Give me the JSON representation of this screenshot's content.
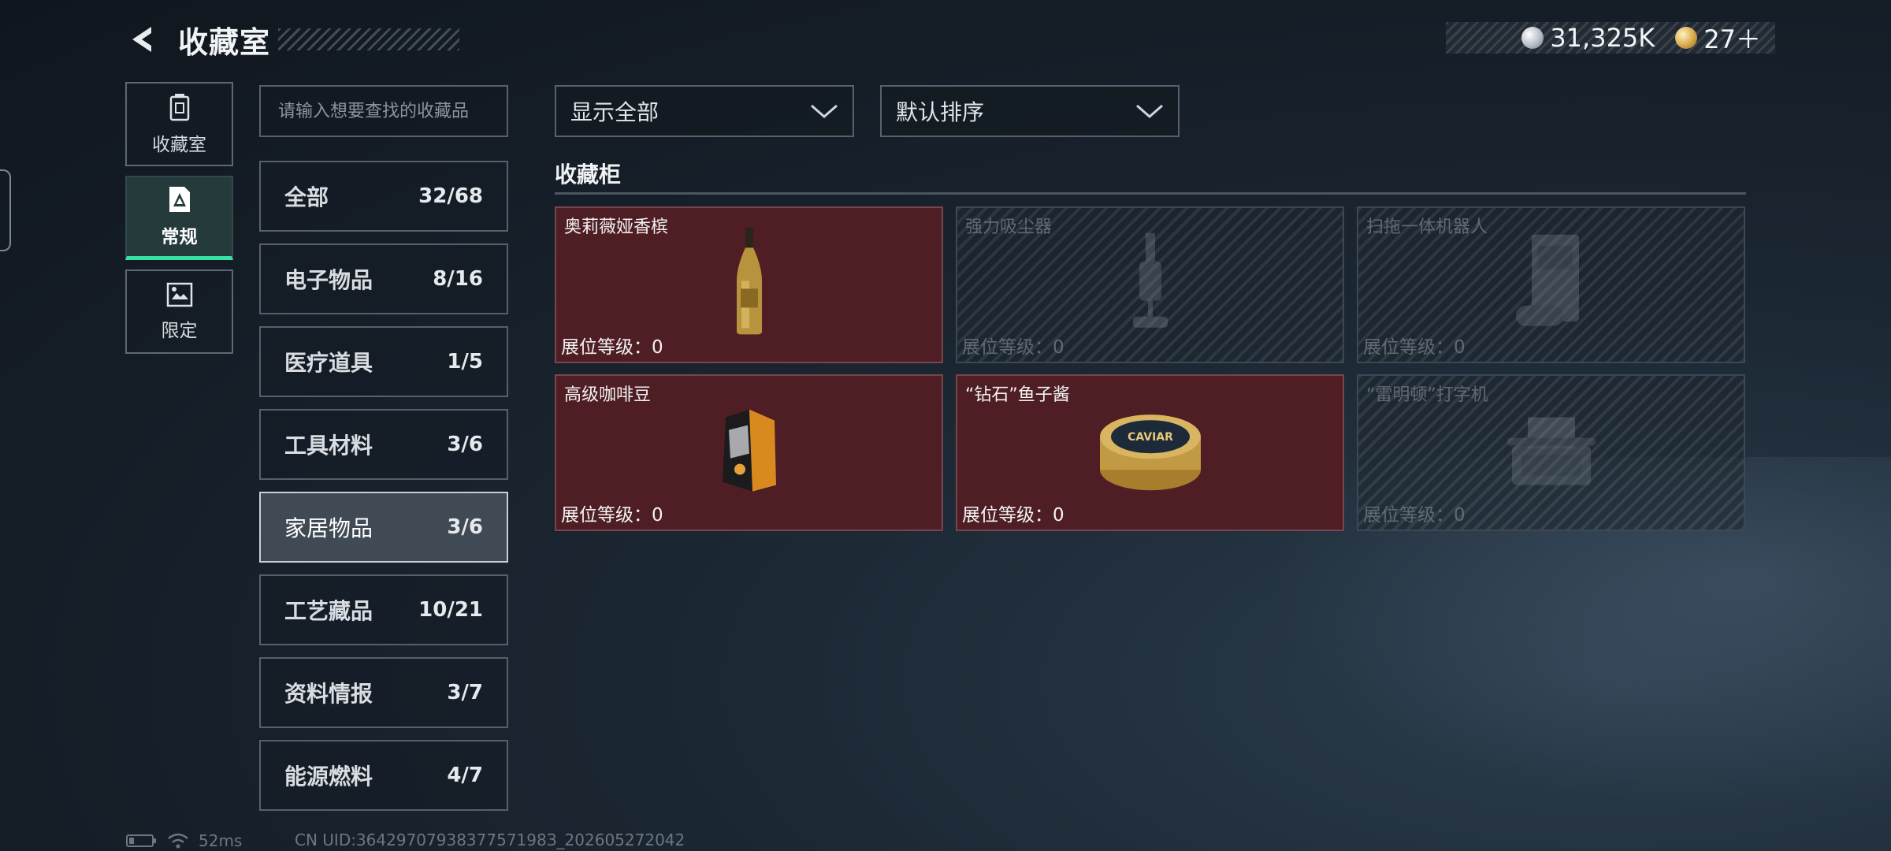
{
  "header": {
    "title": "收藏室",
    "currency": {
      "silver_amount": "31,325K",
      "gold_amount": "27＋"
    }
  },
  "sidenav": {
    "items": [
      {
        "label": "收藏室",
        "icon": "trash-bin-icon",
        "active": false
      },
      {
        "label": "常规",
        "icon": "document-a-icon",
        "active": true
      },
      {
        "label": "限定",
        "icon": "limited-card-icon",
        "active": false
      }
    ]
  },
  "search": {
    "placeholder": "请输入想要查找的收藏品"
  },
  "categories": [
    {
      "name": "全部",
      "count": "32/68"
    },
    {
      "name": "电子物品",
      "count": "8/16"
    },
    {
      "name": "医疗道具",
      "count": "1/5"
    },
    {
      "name": "工具材料",
      "count": "3/6"
    },
    {
      "name": "家居物品",
      "count": "3/6",
      "active": true
    },
    {
      "name": "工艺藏品",
      "count": "10/21"
    },
    {
      "name": "资料情报",
      "count": "3/7"
    },
    {
      "name": "能源燃料",
      "count": "4/7"
    }
  ],
  "filters": {
    "display": "显示全部",
    "sort": "默认排序"
  },
  "cabinet": {
    "title": "收藏柜",
    "items": [
      {
        "name": "奥莉薇娅香槟",
        "level": "展位等级：0",
        "owned": true,
        "icon": "champagne-bottle-icon"
      },
      {
        "name": "强力吸尘器",
        "level": "展位等级：0",
        "owned": false,
        "icon": "vacuum-cleaner-icon"
      },
      {
        "name": "扫拖一体机器人",
        "level": "展位等级：0",
        "owned": false,
        "icon": "robot-mop-icon"
      },
      {
        "name": "高级咖啡豆",
        "level": "展位等级：0",
        "owned": true,
        "icon": "coffee-bag-icon"
      },
      {
        "name": "“钻石”鱼子酱",
        "level": "展位等级：0",
        "owned": true,
        "icon": "caviar-tin-icon",
        "tin_label": "CAVIAR"
      },
      {
        "name": "“雷明顿”打字机",
        "level": "展位等级：0",
        "owned": false,
        "icon": "typewriter-icon"
      }
    ]
  },
  "status": {
    "ping": "52ms",
    "uid": "CN UID:3642970793837757198З_202605272042"
  },
  "colors": {
    "accent_green": "#38e0a6",
    "owned_card": "#4f1e24",
    "locked_card": "#2a333c"
  }
}
